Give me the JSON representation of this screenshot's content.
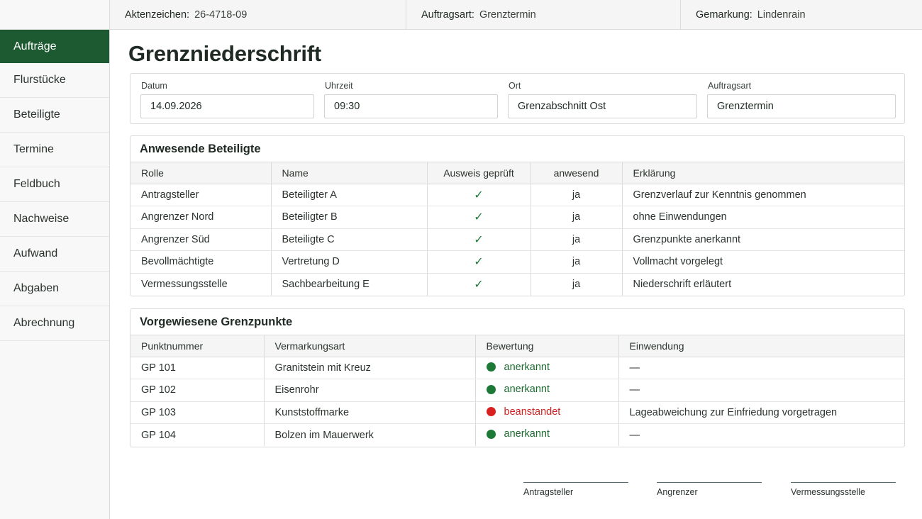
{
  "header": {
    "aktenzeichen_label": "Aktenzeichen:",
    "aktenzeichen_value": "26-4718-09",
    "auftragsart_label": "Auftragsart:",
    "auftragsart_value": "Grenztermin",
    "gemarkung_label": "Gemarkung:",
    "gemarkung_value": "Lindenrain"
  },
  "sidebar": {
    "items": [
      {
        "label": "Aufträge",
        "active": true
      },
      {
        "label": "Flurstücke"
      },
      {
        "label": "Beteiligte"
      },
      {
        "label": "Termine"
      },
      {
        "label": "Feldbuch"
      },
      {
        "label": "Nachweise"
      },
      {
        "label": "Aufwand"
      },
      {
        "label": "Abgaben"
      },
      {
        "label": "Abrechnung"
      }
    ]
  },
  "page": {
    "title": "Grenzniederschrift"
  },
  "meta": {
    "datum_label": "Datum",
    "datum_value": "14.09.2026",
    "uhrzeit_label": "Uhrzeit",
    "uhrzeit_value": "09:30",
    "ort_label": "Ort",
    "ort_value": "Grenzabschnitt Ost",
    "auftragsart_label": "Auftragsart",
    "auftragsart_value": "Grenztermin"
  },
  "beteiligte": {
    "title": "Anwesende Beteiligte",
    "columns": [
      "Rolle",
      "Name",
      "Ausweis geprüft",
      "anwesend",
      "Erklärung"
    ],
    "check_glyph": "✓",
    "rows": [
      {
        "rolle": "Antragsteller",
        "name": "Beteiligter A",
        "anwesend": "ja",
        "erklaerung": "Grenzverlauf zur Kenntnis genommen"
      },
      {
        "rolle": "Angrenzer Nord",
        "name": "Beteiligter B",
        "anwesend": "ja",
        "erklaerung": "ohne Einwendungen"
      },
      {
        "rolle": "Angrenzer Süd",
        "name": "Beteiligte C",
        "anwesend": "ja",
        "erklaerung": "Grenzpunkte anerkannt"
      },
      {
        "rolle": "Bevollmächtigte",
        "name": "Vertretung D",
        "anwesend": "ja",
        "erklaerung": "Vollmacht vorgelegt"
      },
      {
        "rolle": "Vermessungsstelle",
        "name": "Sachbearbeitung E",
        "anwesend": "ja",
        "erklaerung": "Niederschrift erläutert"
      }
    ]
  },
  "grenzpunkte": {
    "title": "Vorgewiesene Grenzpunkte",
    "columns": [
      "Punktnummer",
      "Vermarkungsart",
      "Bewertung",
      "Einwendung"
    ],
    "rows": [
      {
        "punkt": "GP 101",
        "art": "Granitstein mit Kreuz",
        "bewertung": "anerkannt",
        "status": "ok",
        "einwendung": "—"
      },
      {
        "punkt": "GP 102",
        "art": "Eisenrohr",
        "bewertung": "anerkannt",
        "status": "ok",
        "einwendung": "—"
      },
      {
        "punkt": "GP 103",
        "art": "Kunststoffmarke",
        "bewertung": "beanstandet",
        "status": "bad",
        "einwendung": "Lageabweichung zur Einfriedung vorgetragen"
      },
      {
        "punkt": "GP 104",
        "art": "Bolzen im Mauerwerk",
        "bewertung": "anerkannt",
        "status": "ok",
        "einwendung": "—"
      }
    ]
  },
  "signatures": {
    "antragsteller": "Antragsteller",
    "angrenzer": "Angrenzer",
    "vermessungsstelle": "Vermessungsstelle"
  },
  "colors": {
    "accent": "#1d5a31",
    "ok": "#1d7a36",
    "bad": "#d92020"
  }
}
